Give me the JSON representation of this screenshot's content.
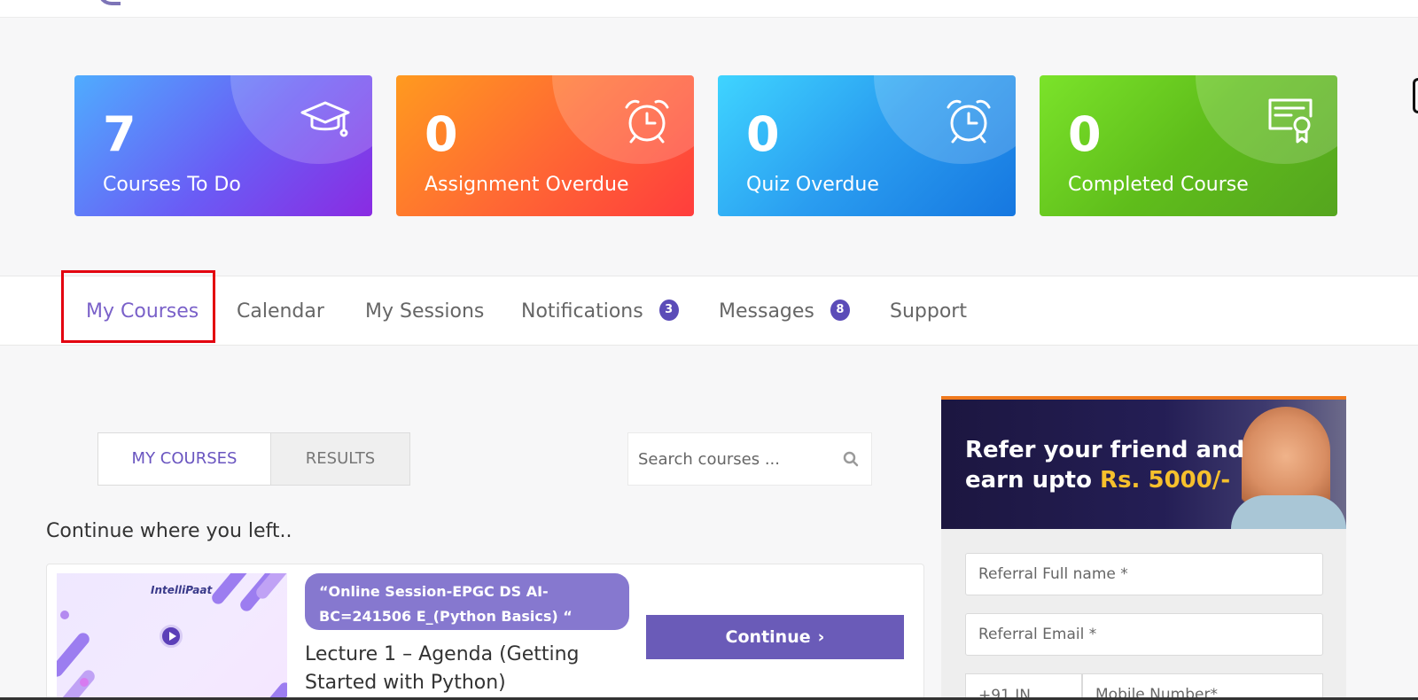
{
  "stats": [
    {
      "value": "7",
      "label": "Courses To Do",
      "icon": "graduation-cap-icon"
    },
    {
      "value": "0",
      "label": "Assignment Overdue",
      "icon": "alarm-clock-icon"
    },
    {
      "value": "0",
      "label": "Quiz Overdue",
      "icon": "alarm-clock-icon"
    },
    {
      "value": "0",
      "label": "Completed Course",
      "icon": "certificate-icon"
    }
  ],
  "tabs": [
    {
      "label": "My Courses",
      "active": true
    },
    {
      "label": "Calendar"
    },
    {
      "label": "My Sessions"
    },
    {
      "label": "Notifications",
      "badge": "3"
    },
    {
      "label": "Messages",
      "badge": "8"
    },
    {
      "label": "Support"
    }
  ],
  "subtabs": {
    "my_courses": "MY COURSES",
    "results": "RESULTS"
  },
  "search": {
    "placeholder": "Search courses ..."
  },
  "continue_title": "Continue where you left..",
  "course": {
    "brand": "IntelliPaat",
    "session": "“Online Session-EPGC DS AI-BC=241506 E_(Python Basics) “",
    "lecture": "Lecture 1 – Agenda (Getting Started with Python)",
    "button": "Continue"
  },
  "referral": {
    "line1": "Refer your friend and",
    "line2_prefix": "earn upto",
    "amount": "Rs. 5000/-",
    "name_placeholder": "Referral Full name *",
    "email_placeholder": "Referral Email *",
    "country_code": "+91  IN",
    "mobile_placeholder": "Mobile Number*"
  },
  "colors": {
    "accent": "#7a61c9",
    "button": "#6a5bb8",
    "badge": "#5b4cb8",
    "highlight": "#e3000f",
    "referral_amount": "#f6c02c"
  }
}
